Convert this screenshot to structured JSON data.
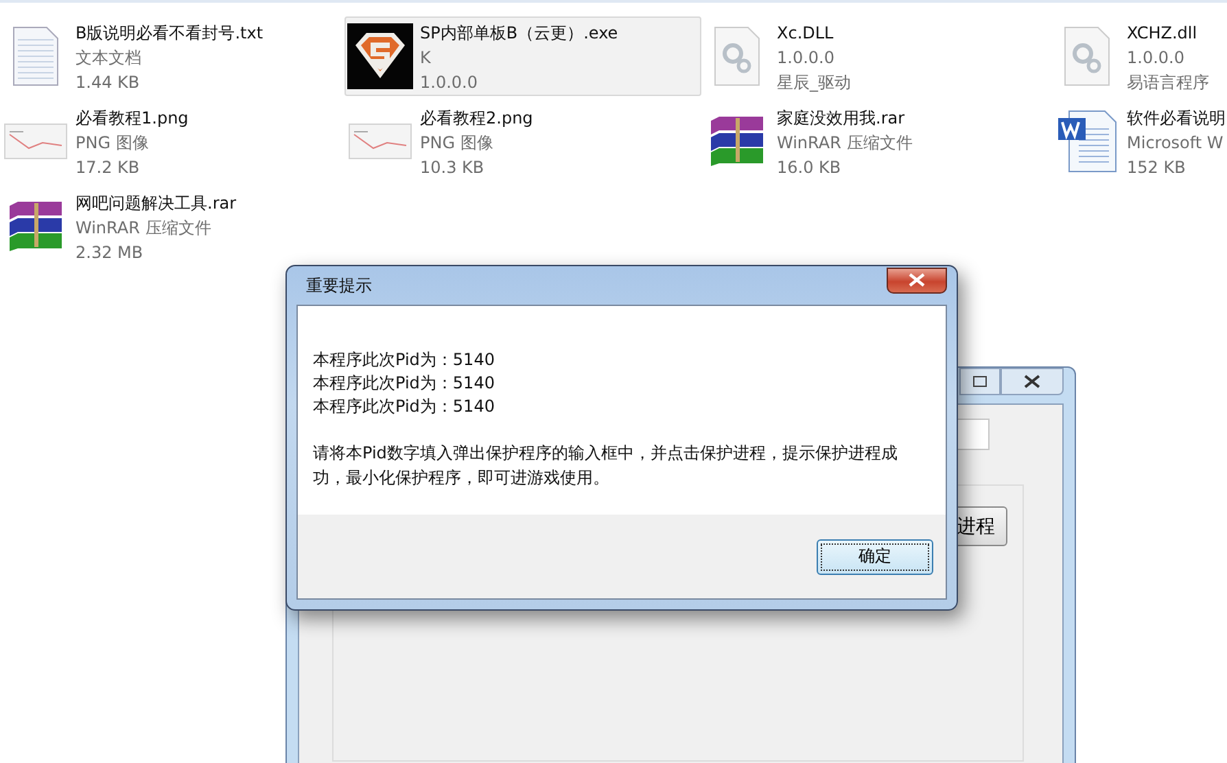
{
  "files": [
    {
      "kind": "txt",
      "name": "B版说明必看不看封号.txt",
      "line_2": "文本文档",
      "line_3": "1.44 KB",
      "selected": false
    },
    {
      "kind": "exe",
      "name": "SP内部单板B（云更）.exe",
      "line_2": "K",
      "line_3": "1.0.0.0",
      "selected": true
    },
    {
      "kind": "dll",
      "name": "Xc.DLL",
      "line_2": "1.0.0.0",
      "line_3": "星辰_驱动",
      "selected": false
    },
    {
      "kind": "dll",
      "name": "XCHZ.dll",
      "line_2": "1.0.0.0",
      "line_3": "易语言程序",
      "selected": false
    },
    {
      "kind": "png",
      "name": "必看教程1.png",
      "line_2": "PNG 图像",
      "line_3": "17.2 KB",
      "selected": false
    },
    {
      "kind": "png",
      "name": "必看教程2.png",
      "line_2": "PNG 图像",
      "line_3": "10.3 KB",
      "selected": false
    },
    {
      "kind": "rar",
      "name": "家庭没效用我.rar",
      "line_2": "WinRAR 压缩文件",
      "line_3": "16.0 KB",
      "selected": false
    },
    {
      "kind": "doc",
      "name": "软件必看说明",
      "line_2": "Microsoft W",
      "line_3": "152 KB",
      "selected": false
    },
    {
      "kind": "rar",
      "name": "网吧问题解决工具.rar",
      "line_2": "WinRAR 压缩文件",
      "line_3": "2.32 MB",
      "selected": false
    }
  ],
  "background_window": {
    "button": "进程"
  },
  "dialog": {
    "title": "重要提示",
    "lines": [
      "本程序此次Pid为：5140",
      "本程序此次Pid为：5140",
      "本程序此次Pid为：5140"
    ],
    "message": "请将本Pid数字填入弹出保护程序的输入框中，并点击保护进程，提示保护进程成功，最小化保护程序，即可进游戏使用。",
    "button": "确定"
  }
}
